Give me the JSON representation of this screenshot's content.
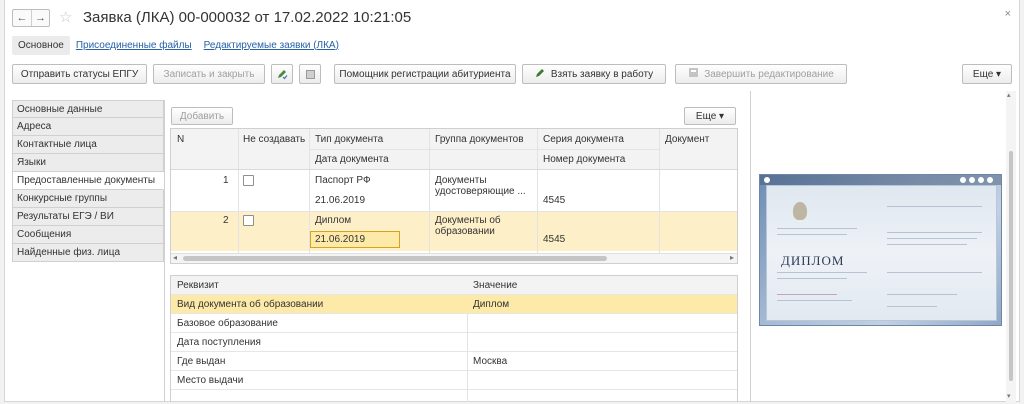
{
  "window": {
    "title": "Заявка (ЛКА) 00-000032 от 17.02.2022 10:21:05",
    "back_arrow": "←",
    "forward_arrow": "→",
    "star": "☆",
    "close": "×"
  },
  "tabs": [
    {
      "label": "Основное",
      "active": true
    },
    {
      "label": "Присоединенные файлы",
      "active": false
    },
    {
      "label": "Редактируемые заявки (ЛКА)",
      "active": false
    }
  ],
  "toolbar": {
    "send_statuses": "Отправить статусы ЕПГУ",
    "save_close": "Записать и закрыть",
    "assistant": "Помощник регистрации абитуриента",
    "take_work": "Взять заявку в работу",
    "finish_edit": "Завершить редактирование",
    "more": "Еще ▾"
  },
  "leftnav": {
    "items": [
      "Основные данные",
      "Адреса",
      "Контактные лица",
      "Языки",
      "Предоставленные документы",
      "Конкурсные группы",
      "Результаты ЕГЭ / ВИ",
      "Сообщения",
      "Найденные физ. лица"
    ],
    "active_index": 4
  },
  "docs": {
    "add_label": "Добавить",
    "more_label": "Еще ▾",
    "headers": {
      "n": "N",
      "no_create": "Не создавать",
      "doc_type": "Тип документа",
      "doc_date": "Дата документа",
      "doc_group": "Группа документов",
      "doc_series": "Серия документа",
      "doc_number": "Номер документа",
      "doc": "Документ"
    },
    "rows": [
      {
        "n": "1",
        "type": "Паспорт РФ",
        "date": "21.06.2019",
        "group": "Документы удостоверяющие ...",
        "series": "",
        "number": "4545"
      },
      {
        "n": "2",
        "type": "Диплом",
        "date": "21.06.2019",
        "group": "Документы об образовании",
        "series": "",
        "number": "4545"
      }
    ],
    "scroll_left": "◂",
    "scroll_right": "▸"
  },
  "props": {
    "header_key": "Реквизит",
    "header_value": "Значение",
    "rows": [
      {
        "key": "Вид документа об образовании",
        "value": "Диплом"
      },
      {
        "key": "Базовое образование",
        "value": ""
      },
      {
        "key": "Дата поступления",
        "value": ""
      },
      {
        "key": "Где выдан",
        "value": "Москва"
      },
      {
        "key": "Место выдачи",
        "value": ""
      }
    ]
  },
  "preview": {
    "word": "ДИПЛОМ",
    "scroll_up": "▴",
    "scroll_down": "▾"
  }
}
